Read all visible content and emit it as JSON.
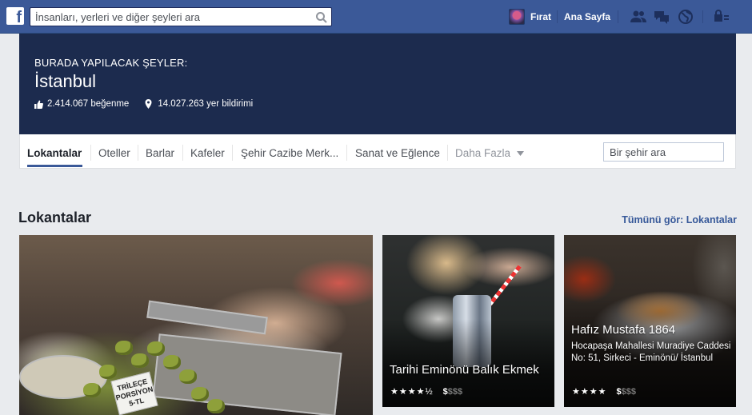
{
  "topbar": {
    "logo_letter": "f",
    "search_placeholder": "İnsanları, yerleri ve diğer şeyleri ara",
    "profile_name": "Fırat",
    "home_label": "Ana Sayfa"
  },
  "hero": {
    "kicker": "BURADA YAPILACAK ŞEYLER:",
    "title": "İstanbul",
    "likes": "2.414.067 beğenme",
    "checkins": "14.027.263 yer bildirimi"
  },
  "tabs": {
    "items": [
      "Lokantalar",
      "Oteller",
      "Barlar",
      "Kafeler",
      "Şehir Cazibe Merk...",
      "Sanat ve Eğlence"
    ],
    "more": "Daha Fazla",
    "city_search_placeholder": "Bir şehir ara"
  },
  "section": {
    "title": "Lokantalar",
    "see_all": "Tümünü gör: Lokantalar"
  },
  "cards": [
    {
      "name": "",
      "sign_text": "TRİLEÇE PORSİYON 5-TL"
    },
    {
      "name": "Tarihi Eminönü Balık Ekmek",
      "stars": "★★★★½",
      "price_filled": "$",
      "price_dim": "$$$"
    },
    {
      "name": "Hafız Mustafa 1864",
      "address": "Hocapaşa Mahallesi Muradiye Caddesi No: 51, Sirkeci - Eminönü/ İstanbul",
      "stars": "★★★★",
      "price_filled": "$",
      "price_dim": "$$$"
    }
  ],
  "colors": {
    "brand": "#3b5998",
    "hero_bg": "#1c2b4e",
    "link": "#365899"
  }
}
